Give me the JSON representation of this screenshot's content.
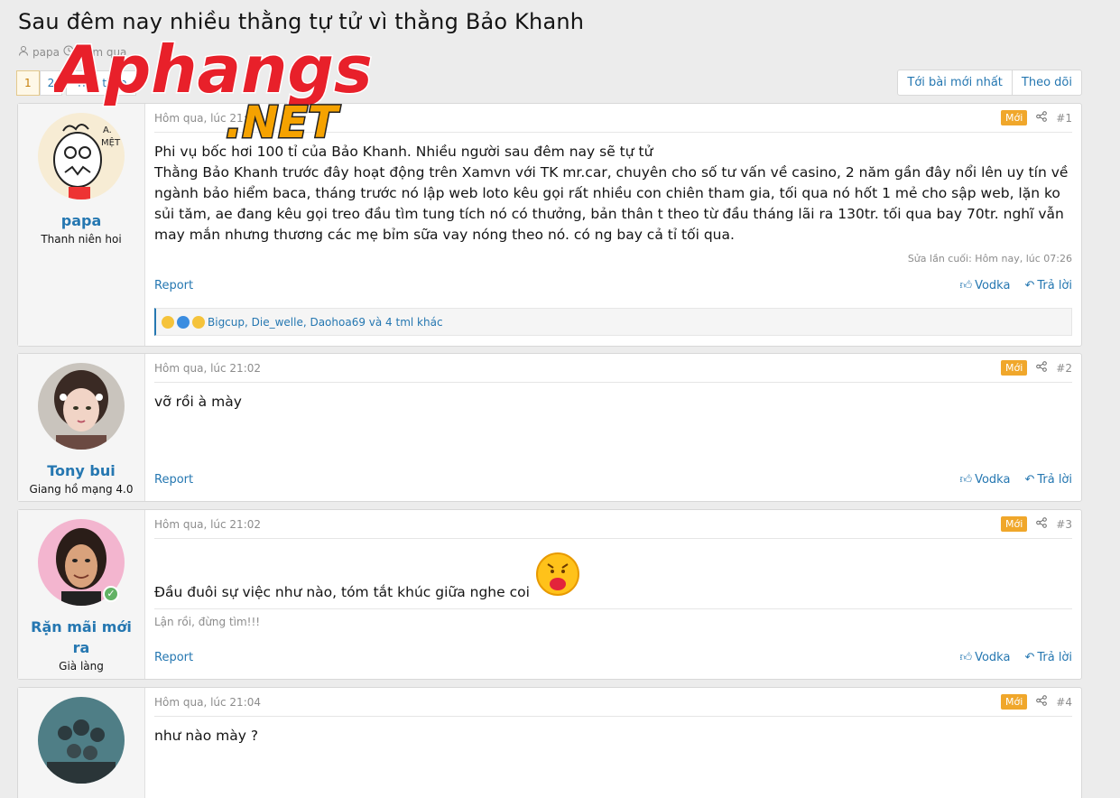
{
  "thread": {
    "title": "Sau đêm nay nhiều thằng tự tử vì thằng Bảo Khanh",
    "author": "papa",
    "date": "Hôm qua"
  },
  "pagination": {
    "pages": [
      "1",
      "2"
    ],
    "next_label": "Tiếp theo"
  },
  "top_buttons": {
    "newest": "Tới bài mới nhất",
    "watch": "Theo dõi"
  },
  "badge_label": "Mới",
  "report_label": "Report",
  "like_label": "Vodka",
  "reply_label": "Trả lời",
  "logo_text": {
    "main": "Aphangs",
    "sub": ".NET"
  },
  "posts": [
    {
      "user": "papa",
      "user_title": "Thanh niên hoi",
      "time": "Hôm qua, lúc 21:01",
      "number": "#1",
      "content": "Phi vụ bốc hơi 100 tỉ của Bảo Khanh. Nhiều người sau đêm nay sẽ tự tử\nThằng Bảo Khanh trước đây hoạt động trên Xamvn với TK mr.car, chuyên cho số tư vấn về casino, 2 năm gần đây nổi lên uy tín về ngành bảo hiểm baca, tháng trước nó lập web loto kêu gọi rất nhiều con chiên tham gia, tối qua nó hốt 1 mẻ cho sập web, lặn ko sủi tăm, ae đang kêu gọi treo đầu tìm tung tích nó có thưởng, bản thân t theo từ đầu tháng lãi ra 130tr. tối qua bay 70tr. nghĩ vẫn may mắn nhưng thương các mẹ bỉm sữa vay nóng theo nó. có ng bay cả tỉ tối qua.",
      "edited": "Sửa lần cuối: Hôm nay, lúc 07:26",
      "reactions": "Bigcup, Die_welle, Daohoa69 và 4 tml khác"
    },
    {
      "user": "Tony bui",
      "user_title": "Giang hồ mạng 4.0",
      "time": "Hôm qua, lúc 21:02",
      "number": "#2",
      "content": "vỡ rồi à mày"
    },
    {
      "user": "Rặn mãi mới ra",
      "user_title": "Già làng",
      "time": "Hôm qua, lúc 21:02",
      "number": "#3",
      "content": "Đầu đuôi sự việc như nào, tóm tắt khúc giữa nghe coi",
      "signature": "Lận rồi, đừng tìm!!!"
    },
    {
      "user": "",
      "user_title": "",
      "time": "Hôm qua, lúc 21:04",
      "number": "#4",
      "content": "như nào mày ?"
    }
  ],
  "colors": {
    "link": "#2577b1",
    "badge": "#f0a72b",
    "background": "#ececec"
  }
}
